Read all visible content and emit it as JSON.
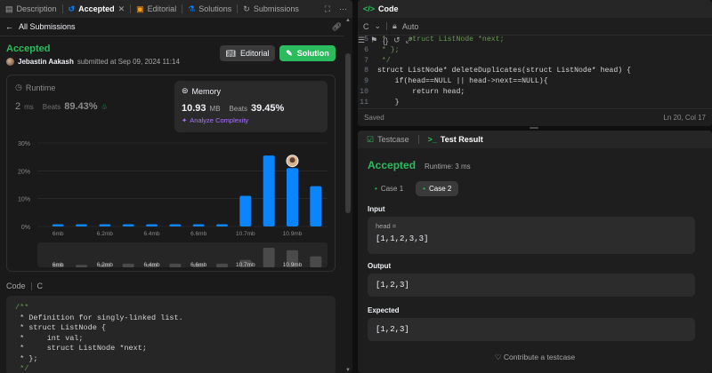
{
  "left_tabs": {
    "description": "Description",
    "accepted": "Accepted",
    "editorial": "Editorial",
    "solutions": "Solutions",
    "submissions": "Submissions"
  },
  "sub_header": {
    "back_label": "All Submissions"
  },
  "submission": {
    "status": "Accepted",
    "author": "Jebastin Aakash",
    "submitted_text": "submitted at Sep 09, 2024 11:14",
    "editorial_btn": "Editorial",
    "solution_btn": "Solution"
  },
  "runtime": {
    "title": "Runtime",
    "value": "2",
    "unit": "ms",
    "beats_label": "Beats",
    "beats_pct": "89.43%"
  },
  "memory": {
    "title": "Memory",
    "value": "10.93",
    "unit": "MB",
    "beats_label": "Beats",
    "beats_pct": "39.45%",
    "analyze": "Analyze Complexity"
  },
  "chart_data": {
    "type": "bar",
    "categories": [
      "6mb",
      "",
      "6.2mb",
      "",
      "6.4mb",
      "",
      "6.6mb",
      "",
      "10.7mb",
      "",
      "10.9mb",
      ""
    ],
    "values": [
      0.8,
      0.8,
      0.8,
      0.8,
      0.8,
      0.8,
      0.8,
      0.8,
      11,
      25.5,
      21,
      14.5
    ],
    "y_ticks": [
      "30%",
      "20%",
      "10%",
      "0%"
    ],
    "ylim": [
      0,
      30
    ],
    "highlight_index": 10,
    "bar_color": "#0a84ff",
    "mini_values": [
      0.3,
      0.2,
      0.3,
      0.3,
      0.3,
      0.3,
      0.3,
      0.3,
      0.6,
      1.6,
      1.4,
      0.9
    ],
    "grid": true
  },
  "code_section": {
    "label": "Code",
    "lang": "C",
    "lines": [
      {
        "text": "/**",
        "comment": true
      },
      {
        "text": " * Definition for singly-linked list.",
        "comment": false
      },
      {
        "text": " * struct ListNode {",
        "comment": false
      },
      {
        "text": " *     int val;",
        "comment": false
      },
      {
        "text": " *     struct ListNode *next;",
        "comment": false
      },
      {
        "text": " * };",
        "comment": false
      },
      {
        "text": " */",
        "comment": true
      }
    ]
  },
  "editor": {
    "title": "Code",
    "lang": "C",
    "mode": "Auto",
    "lines": [
      {
        "n": "5",
        "text": " *     struct ListNode *next;",
        "comment": true
      },
      {
        "n": "6",
        "text": " * };",
        "comment": true
      },
      {
        "n": "7",
        "text": " */",
        "comment": true
      },
      {
        "n": "8",
        "text": "struct ListNode* deleteDuplicates(struct ListNode* head) {",
        "comment": false
      },
      {
        "n": "9",
        "text": "    if(head==NULL || head->next==NULL){",
        "comment": false
      },
      {
        "n": "10",
        "text": "        return head;",
        "comment": false
      },
      {
        "n": "11",
        "text": "    }",
        "comment": false
      }
    ],
    "saved": "Saved",
    "cursor": "Ln 20, Col 17"
  },
  "test": {
    "tab_testcase": "Testcase",
    "tab_result": "Test Result",
    "status": "Accepted",
    "runtime": "Runtime: 3 ms",
    "case1": "Case 1",
    "case2": "Case 2",
    "input_label": "Input",
    "input_var": "head =",
    "input_value": "[1,1,2,3,3]",
    "output_label": "Output",
    "output_value": "[1,2,3]",
    "expected_label": "Expected",
    "expected_value": "[1,2,3]",
    "contribute": "Contribute a testcase"
  }
}
